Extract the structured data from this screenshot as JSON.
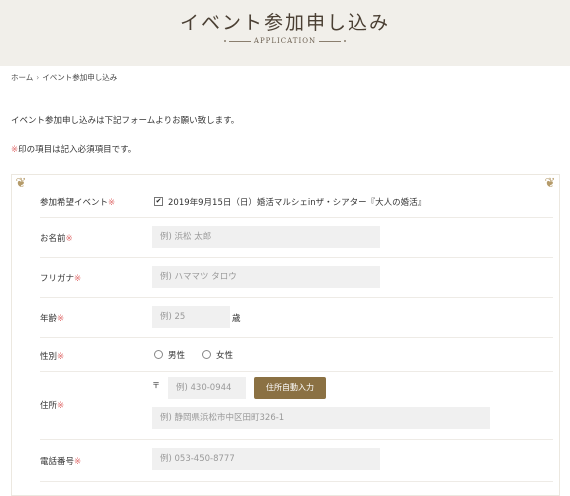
{
  "header": {
    "title": "イベント参加申し込み",
    "subtitle": "APPLICATION"
  },
  "breadcrumb": {
    "home": "ホーム",
    "separator": "›",
    "current": "イベント参加申し込み"
  },
  "intro_text": "イベント参加申し込みは下記フォームよりお願い致します。",
  "required_note": {
    "mark": "※",
    "text": "印の項目は記入必須項目です。"
  },
  "form": {
    "required_mark": "※",
    "event": {
      "label": "参加希望イベント",
      "option": "2019年9月15日（日）婚活マルシェinザ・シアター『大人の婚活』",
      "checked": true
    },
    "name": {
      "label": "お名前",
      "placeholder": "例) 浜松 太郎",
      "value": ""
    },
    "furigana": {
      "label": "フリガナ",
      "placeholder": "例) ハママツ タロウ",
      "value": ""
    },
    "age": {
      "label": "年齢",
      "placeholder": "例) 25",
      "unit": "歳",
      "value": ""
    },
    "gender": {
      "label": "性別",
      "options": [
        "男性",
        "女性"
      ]
    },
    "address": {
      "label": "住所",
      "postal_mark": "〒",
      "postal_placeholder": "例) 430-0944",
      "auto_button": "住所自動入力",
      "address_placeholder": "例) 静岡県浜松市中区田町326-1"
    },
    "phone": {
      "label": "電話番号",
      "placeholder": "例) 053-450-8777",
      "value": ""
    }
  },
  "colors": {
    "accent_button": "#8b7143",
    "required": "#e07070",
    "hero_bg": "#f1efea"
  }
}
